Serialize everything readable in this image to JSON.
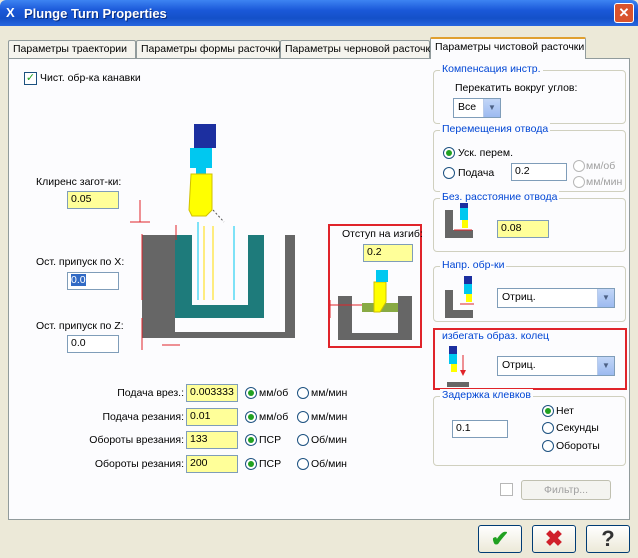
{
  "window": {
    "title": "Plunge Turn Properties",
    "app_icon": "X",
    "close_glyph": "✕"
  },
  "tabs": [
    {
      "label": "Параметры траектории"
    },
    {
      "label": "Параметры формы расточки"
    },
    {
      "label": "Параметры черновой расточки"
    },
    {
      "label": "Параметры чистовой расточки"
    }
  ],
  "finish_groove": {
    "label": "Чист. обр-ка канавки",
    "checked": true
  },
  "stock_clearance": {
    "label": "Клиренс загот-ки:",
    "value": "0.05"
  },
  "stock_x": {
    "label": "Ост. припуск по X:",
    "value": "0.0"
  },
  "stock_z": {
    "label": "Ост. припуск по Z:",
    "value": "0.0"
  },
  "bend_offset": {
    "label": "Отступ на изгиб:",
    "value": "0.2"
  },
  "rows": [
    {
      "label": "Подача врез.:",
      "value": "0.003333",
      "opt1": "мм/об",
      "opt2": "мм/мин"
    },
    {
      "label": "Подача резания:",
      "value": "0.01",
      "opt1": "мм/об",
      "opt2": "мм/мин"
    },
    {
      "label": "Обороты врезания:",
      "value": "133",
      "opt1": "ПСР",
      "opt2": "Об/мин"
    },
    {
      "label": "Обороты резания:",
      "value": "200",
      "opt1": "ПСР",
      "opt2": "Об/мин"
    }
  ],
  "comp": {
    "title": "Компенсация инстр.",
    "label": "Перекатить вокруг углов:",
    "value": "Все"
  },
  "retract": {
    "title": "Перемещения отвода",
    "rapid": "Уск. перем.",
    "feed": "Подача",
    "value": "0.2",
    "unit1": "мм/об",
    "unit2": "мм/мин"
  },
  "safe": {
    "title": "Без. расстояние отвода",
    "value": "0.08"
  },
  "direction": {
    "title": "Напр. обр-ки",
    "value": "Отриц."
  },
  "avoid": {
    "title": "избегать образ. колец",
    "value": "Отриц."
  },
  "dwell": {
    "title": "Задержка клевков",
    "value": "0.1",
    "opt1": "Нет",
    "opt2": "Секунды",
    "opt3": "Обороты"
  },
  "filter": {
    "label": "Фильтр..."
  },
  "buttons": {
    "ok": "✔",
    "cancel": "✖",
    "help": "?"
  },
  "colors": {
    "accent_red": "#e0242a",
    "tool_yellow": "#ffff00",
    "part_teal": "#1e7b7b",
    "stock_grey": "#666666"
  }
}
